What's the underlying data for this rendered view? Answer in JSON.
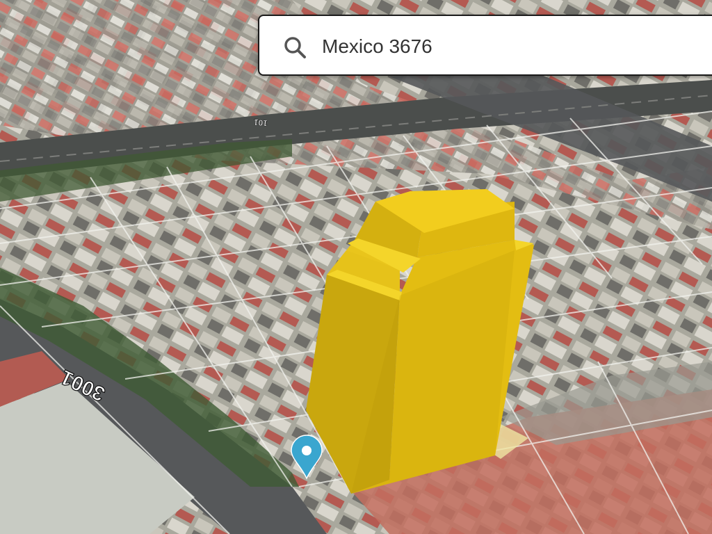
{
  "search": {
    "value": "Mexico 3676",
    "placeholder": ""
  },
  "map": {
    "view": "3d-satellite",
    "street_numbers": [
      "3001",
      "101"
    ],
    "building_highlight_color": "#e8c414",
    "pin_color": "#3aa6cf"
  },
  "icons": {
    "search": "search-icon",
    "pin": "location-pin-icon"
  }
}
